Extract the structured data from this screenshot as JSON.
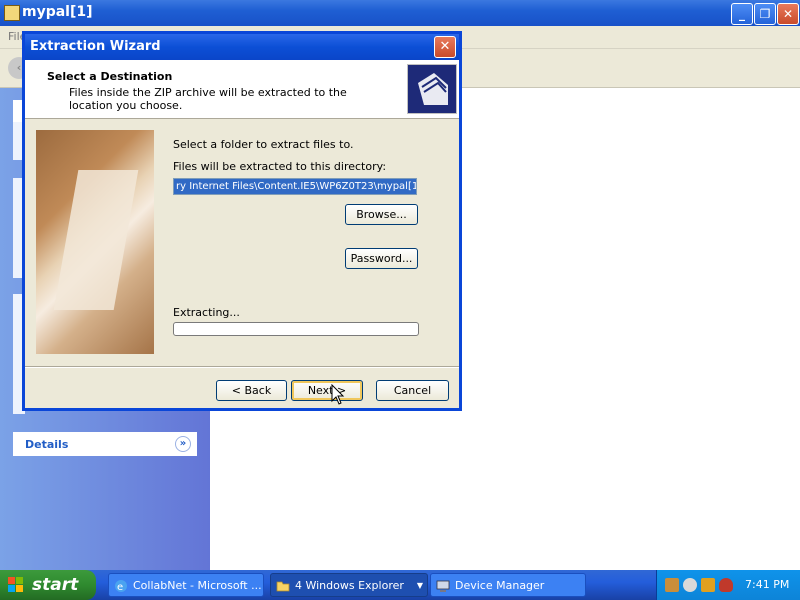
{
  "background_window": {
    "title": "mypal[1]",
    "menu_hint": "File",
    "details_label": "Details"
  },
  "dialog": {
    "title": "Extraction Wizard",
    "header_title": "Select a Destination",
    "header_subtitle": "Files inside the ZIP archive will be extracted to the location you choose.",
    "select_folder_label": "Select a folder to extract files to.",
    "directory_label": "Files will be extracted to this directory:",
    "directory_path": "ry Internet Files\\Content.IE5\\WP6Z0T23\\mypal[1]",
    "browse_label": "Browse...",
    "password_label": "Password...",
    "extracting_label": "Extracting...",
    "progress_fraction": 0,
    "back_label": "< Back",
    "next_label": "Next >",
    "cancel_label": "Cancel"
  },
  "taskbar": {
    "start_label": "start",
    "tasks": [
      {
        "label": "CollabNet - Microsoft ...",
        "icon": "ie-icon"
      },
      {
        "label": "4 Windows Explorer",
        "icon": "folder-icon"
      },
      {
        "label": "Device Manager",
        "icon": "computer-icon"
      }
    ],
    "clock": "7:41 PM"
  }
}
